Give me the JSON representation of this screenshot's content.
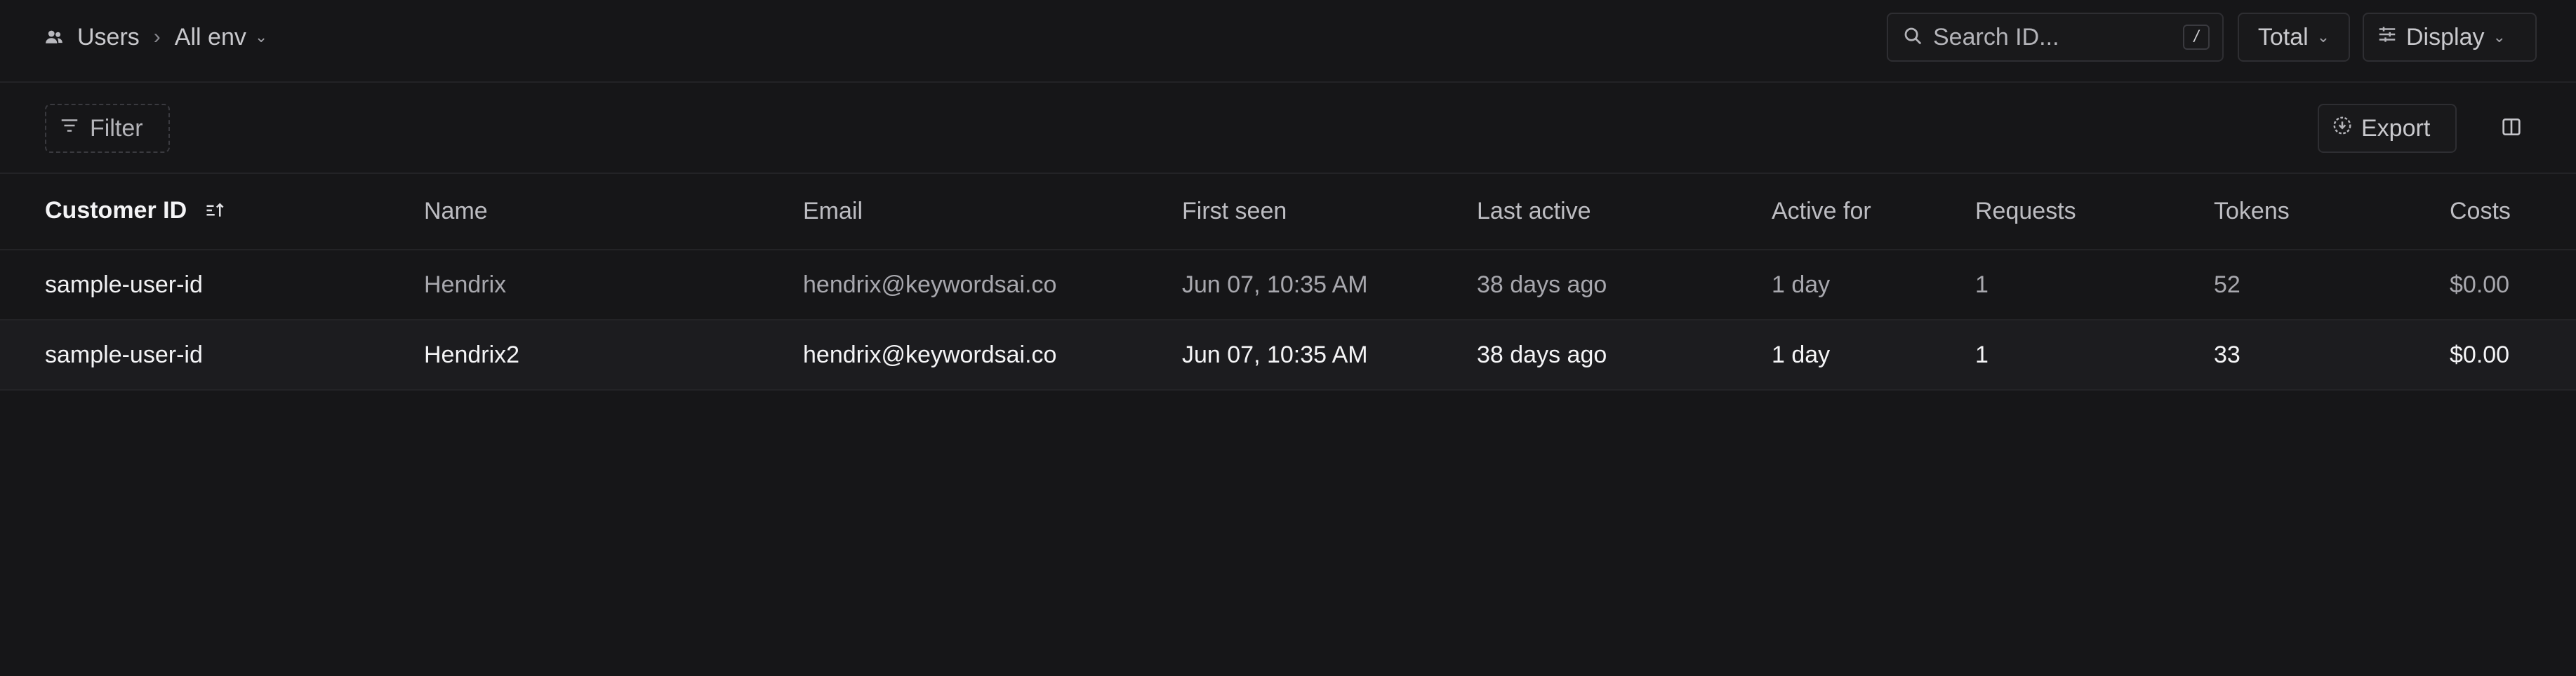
{
  "header": {
    "section": "Users",
    "environment": "All env",
    "search_placeholder": "Search ID...",
    "search_shortcut": "/",
    "metric_select": "Total",
    "display_label": "Display"
  },
  "toolbar": {
    "filter_label": "Filter",
    "export_label": "Export"
  },
  "table": {
    "columns": {
      "customer_id": "Customer ID",
      "name": "Name",
      "email": "Email",
      "first_seen": "First seen",
      "last_active": "Last active",
      "active_for": "Active for",
      "requests": "Requests",
      "tokens": "Tokens",
      "costs": "Costs"
    },
    "rows": [
      {
        "customer_id": "sample-user-id",
        "name": "Hendrix",
        "email": "hendrix@keywordsai.co",
        "first_seen": "Jun 07, 10:35 AM",
        "last_active": "38 days ago",
        "active_for": "1 day",
        "requests": "1",
        "tokens": "52",
        "costs": "$0.00"
      },
      {
        "customer_id": "sample-user-id",
        "name": "Hendrix2",
        "email": "hendrix@keywordsai.co",
        "first_seen": "Jun 07, 10:35 AM",
        "last_active": "38 days ago",
        "active_for": "1 day",
        "requests": "1",
        "tokens": "33",
        "costs": "$0.00"
      }
    ]
  },
  "icons": {
    "breadcrumb": "users-icon",
    "search": "search-icon",
    "display": "sliders-icon",
    "filter": "filter-icon",
    "export": "export-icon",
    "split": "split-view-icon",
    "sort": "sort-icon"
  },
  "colors": {
    "background": "#161618",
    "text_primary": "#f4f4f6",
    "text_secondary": "#a8a8ae",
    "border": "#2e2e32"
  }
}
